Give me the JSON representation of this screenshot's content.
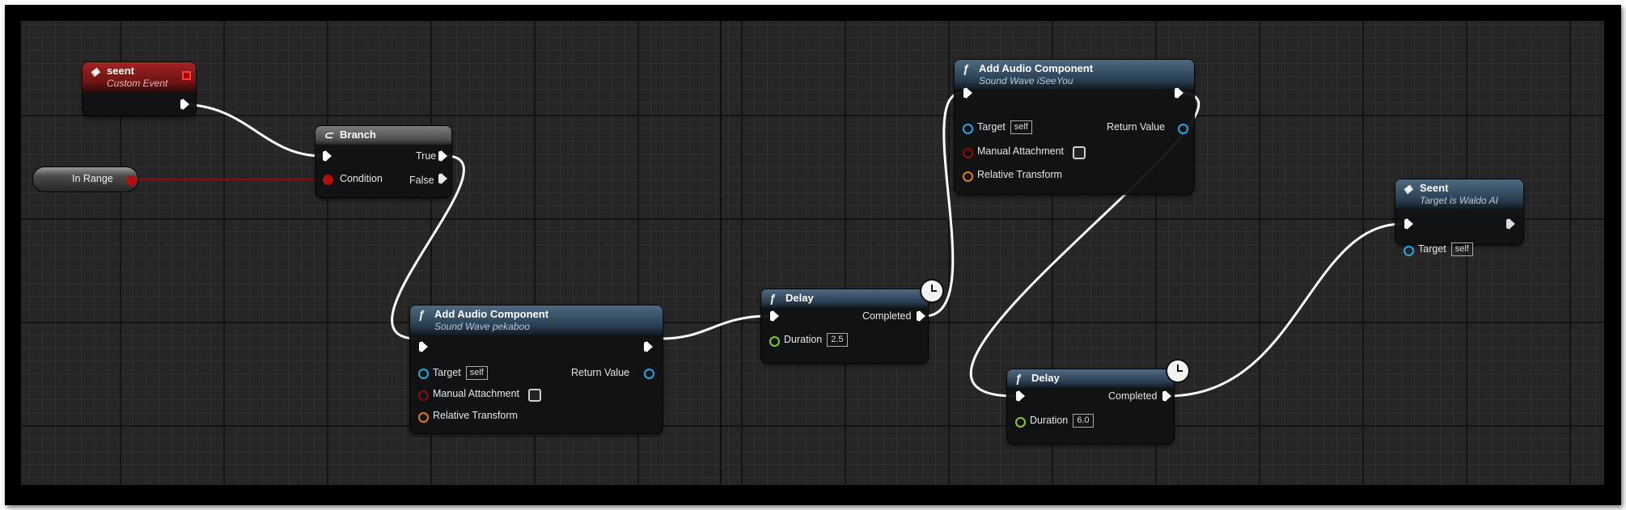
{
  "nodes": {
    "seent_event": {
      "title": "seent",
      "subtitle": "Custom Event"
    },
    "in_range": {
      "label": "In Range"
    },
    "branch": {
      "title": "Branch",
      "condition": "Condition",
      "true_label": "True",
      "false_label": "False"
    },
    "add_audio_1": {
      "title": "Add Audio Component",
      "subtitle": "Sound Wave pekaboo",
      "target": "Target",
      "target_value": "self",
      "return_value": "Return Value",
      "manual_attachment": "Manual Attachment",
      "relative_transform": "Relative Transform"
    },
    "delay_1": {
      "title": "Delay",
      "completed": "Completed",
      "duration": "Duration",
      "duration_value": "2.5"
    },
    "add_audio_2": {
      "title": "Add Audio Component",
      "subtitle": "Sound Wave iSeeYou",
      "target": "Target",
      "target_value": "self",
      "return_value": "Return Value",
      "manual_attachment": "Manual Attachment",
      "relative_transform": "Relative Transform"
    },
    "delay_2": {
      "title": "Delay",
      "completed": "Completed",
      "duration": "Duration",
      "duration_value": "6.0"
    },
    "seent_call": {
      "title": "Seent",
      "subtitle": "Target is Waldo AI",
      "target": "Target",
      "target_value": "self"
    }
  },
  "icons": {
    "event": "diamond-event-icon",
    "function": "function-f-icon",
    "branch": "branch-icon",
    "latent": "clock-icon"
  },
  "colors": {
    "event_header": "#8b1a1a",
    "function_header": "#3e5a72",
    "object_pin": "#2ea4dc",
    "bool_pin": "#8a0c0c",
    "struct_pin": "#e07a12",
    "float_pin": "#83cc20",
    "exec_wire": "#ffffff",
    "bool_wire": "#8a0c0c"
  }
}
